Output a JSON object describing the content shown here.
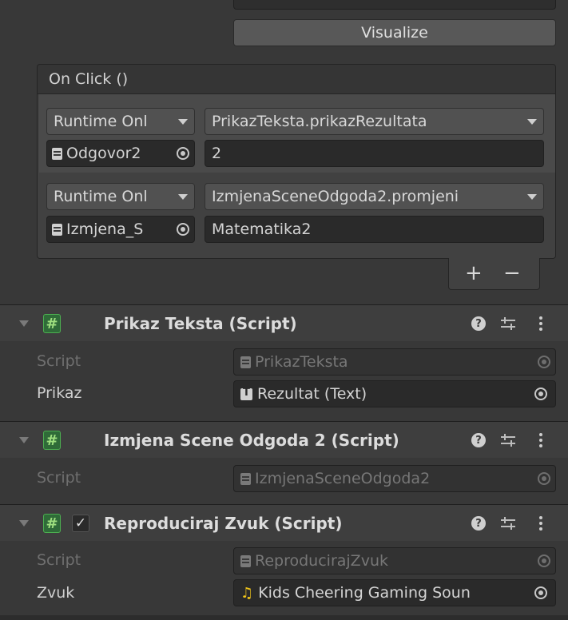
{
  "button": {
    "visualize_label": "Visualize"
  },
  "onclick": {
    "header": "On Click ()",
    "events": [
      {
        "mode": "Runtime Onl",
        "function": "PrikazTeksta.prikazRezultata",
        "object": "Odgovor2",
        "argument": "2"
      },
      {
        "mode": "Runtime Onl",
        "function": "IzmjenaSceneOdgoda2.promjeni",
        "object": "Izmjena_S",
        "argument": "Matematika2"
      }
    ],
    "add_label": "+",
    "remove_label": "−"
  },
  "components": {
    "prikaz": {
      "title": "Prikaz Teksta (Script)",
      "rows": [
        {
          "label": "Script",
          "value": "PrikazTeksta"
        },
        {
          "label": "Prikaz",
          "value": "Rezultat (Text)"
        }
      ]
    },
    "izmjena": {
      "title": "Izmjena Scene Odgoda 2 (Script)",
      "rows": [
        {
          "label": "Script",
          "value": "IzmjenaSceneOdgoda2"
        }
      ]
    },
    "reproduciraj": {
      "title": "Reproduciraj Zvuk (Script)",
      "enabled_check": "✓",
      "rows": [
        {
          "label": "Script",
          "value": "ReproducirajZvuk"
        },
        {
          "label": "Zvuk",
          "value": "Kids Cheering  Gaming Soun"
        }
      ]
    }
  },
  "icons": {
    "script_component": "#",
    "help": "?"
  }
}
